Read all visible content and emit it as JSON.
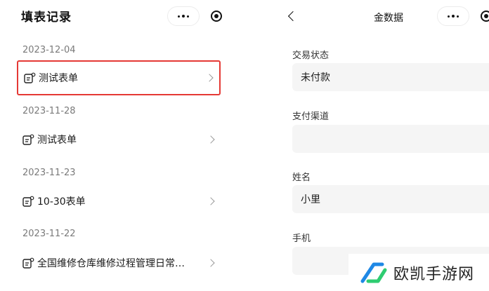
{
  "left": {
    "title": "填表记录",
    "groups": [
      {
        "date": "2023-12-04",
        "item": "测试表单"
      },
      {
        "date": "2023-11-28",
        "item": "测试表单"
      },
      {
        "date": "2023-11-23",
        "item": "10-30表单"
      },
      {
        "date": "2023-11-22",
        "item": "全国维修仓库维修过程管理日常…"
      }
    ]
  },
  "right": {
    "title": "金数据",
    "fields": [
      {
        "label": "交易状态",
        "value": "未付款"
      },
      {
        "label": "支付渠道",
        "value": ""
      },
      {
        "label": "姓名",
        "value": "小里"
      },
      {
        "label": "手机",
        "value": ""
      }
    ]
  },
  "watermark": {
    "text": "欧凯手游网"
  },
  "colors": {
    "highlight": "#e53935",
    "field_bg": "#f5f5f5",
    "watermark_blue": "#1e88e5",
    "watermark_green": "#2ecc71"
  },
  "icons": [
    "more-icon",
    "target-icon",
    "form-icon",
    "chevron-right-icon",
    "back-icon"
  ]
}
